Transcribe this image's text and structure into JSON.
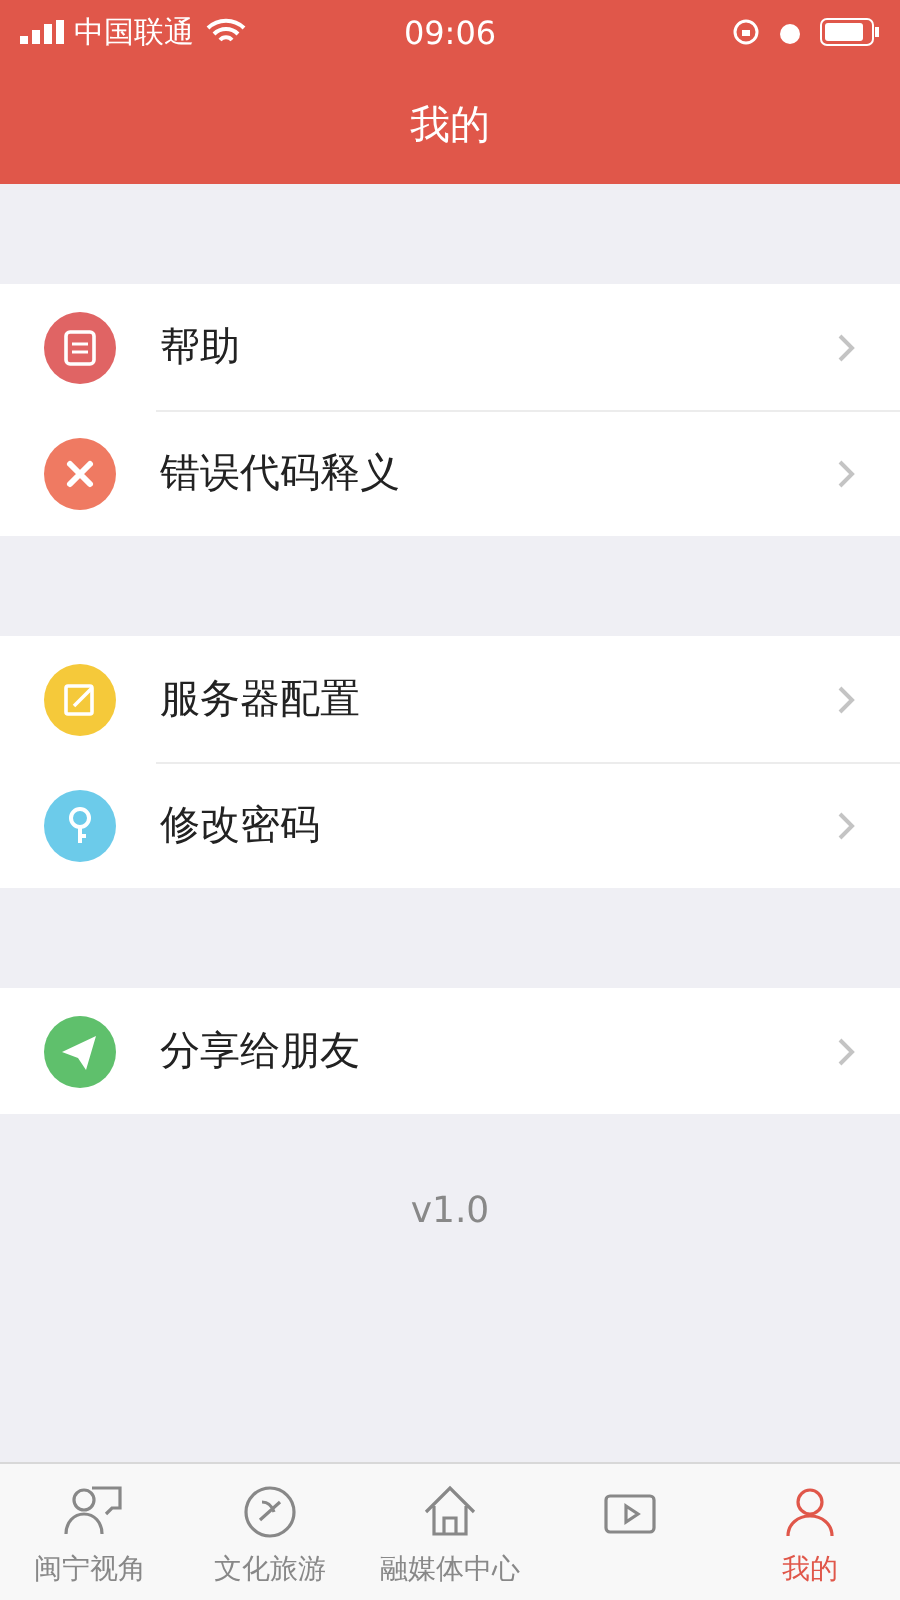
{
  "status_bar": {
    "carrier": "中国联通",
    "time": "09:06"
  },
  "header": {
    "title": "我的"
  },
  "sections": [
    {
      "items": [
        {
          "label": "帮助",
          "color": "#e06464"
        },
        {
          "label": "错误代码释义",
          "color": "#ef7a62"
        }
      ]
    },
    {
      "items": [
        {
          "label": "服务器配置",
          "color": "#f5c93a"
        },
        {
          "label": "修改密码",
          "color": "#6ccbea"
        }
      ]
    },
    {
      "items": [
        {
          "label": "分享给朋友",
          "color": "#5fc06c"
        }
      ]
    }
  ],
  "version": "v1.0",
  "tab_bar": [
    {
      "label": "闽宁视角",
      "selected": false
    },
    {
      "label": "文化旅游",
      "selected": false
    },
    {
      "label": "融媒体中心",
      "selected": false
    },
    {
      "selected": false
    },
    {
      "label": "我的",
      "selected": true
    }
  ]
}
